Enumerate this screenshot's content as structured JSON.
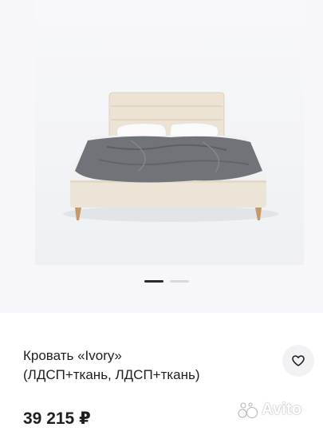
{
  "product": {
    "title_line1": "Кровать «Ivory»",
    "title_line2": "(ЛДСП+ткань, ЛДСП+ткань)",
    "price": "39 215 ₽"
  },
  "gallery": {
    "image_icon": "bed-photo",
    "slide_count": 2,
    "active_slide": 1
  },
  "favorite": {
    "icon": "heart-icon"
  },
  "watermark": {
    "icon": "avito-logo-icon",
    "text": "Avito"
  },
  "colors": {
    "dot_active": "#2b2b2b",
    "dot_inactive": "#d8d8dd",
    "fav_bg": "#f2f2f5",
    "gallery_bg": "#f7f6fa"
  }
}
